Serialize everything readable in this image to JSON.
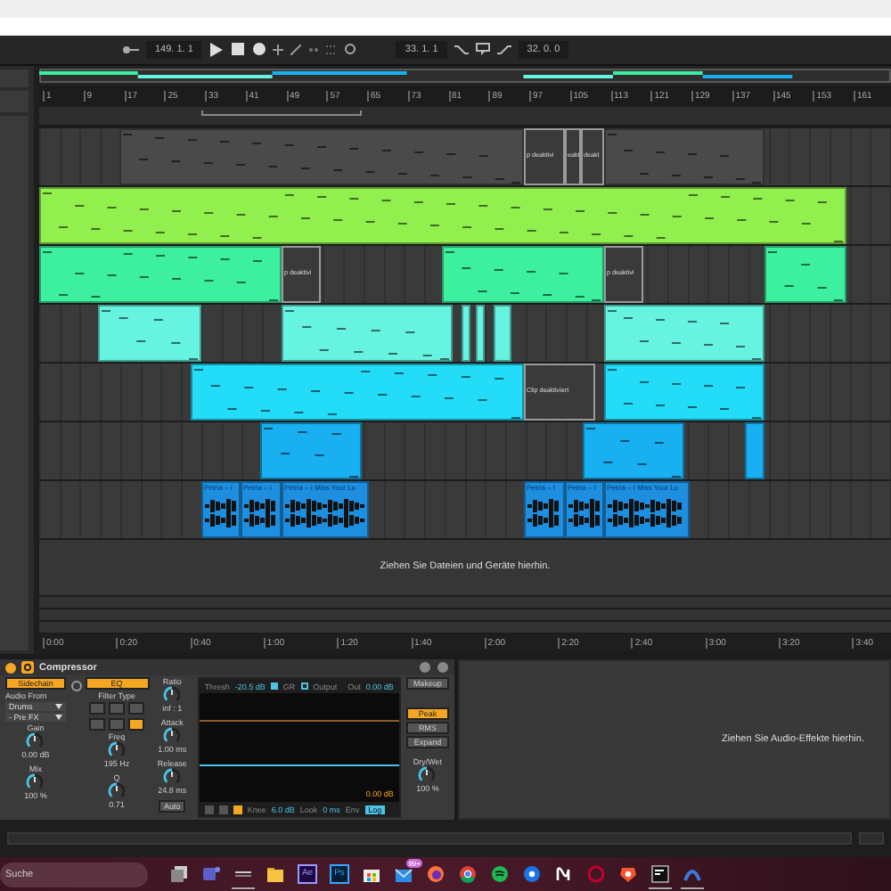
{
  "transport": {
    "position": "149. 1. 1",
    "loop_start": "33. 1. 1",
    "loop_length": "32. 0. 0"
  },
  "ruler": {
    "bars": [
      "1",
      "9",
      "17",
      "25",
      "33",
      "41",
      "49",
      "57",
      "65",
      "73",
      "81",
      "89",
      "97",
      "105",
      "113",
      "121",
      "129",
      "137",
      "145",
      "153",
      "161"
    ],
    "times": [
      "0:00",
      "0:20",
      "0:40",
      "1:00",
      "1:20",
      "1:40",
      "2:00",
      "2:20",
      "2:40",
      "3:00",
      "3:20",
      "3:40"
    ]
  },
  "tracks": [
    {
      "color": "#4a4a4a",
      "clips": [
        {
          "kind": "midi",
          "deactivated": false
        },
        {
          "kind": "midi",
          "deactivated": true,
          "label": "p deaktivi"
        },
        {
          "kind": "midi",
          "deactivated": true,
          "label": "eakt"
        },
        {
          "kind": "midi",
          "deactivated": true,
          "label": "deakt"
        },
        {
          "kind": "midi",
          "deactivated": false
        }
      ]
    },
    {
      "color": "#92f04e",
      "clips": [
        {
          "kind": "midi",
          "deactivated": false
        }
      ]
    },
    {
      "color": "#3cf0a0",
      "clips": [
        {
          "kind": "midi",
          "deactivated": false
        },
        {
          "kind": "midi",
          "deactivated": true,
          "label": "p deaktivi"
        },
        {
          "kind": "midi",
          "deactivated": false
        },
        {
          "kind": "midi",
          "deactivated": true,
          "label": "p deaktivi"
        },
        {
          "kind": "midi",
          "deactivated": false
        }
      ]
    },
    {
      "color": "#66f3df",
      "clips": [
        {
          "kind": "midi",
          "deactivated": false
        },
        {
          "kind": "midi",
          "deactivated": false
        },
        {
          "kind": "midi",
          "deactivated": false
        },
        {
          "kind": "midi",
          "deactivated": false
        },
        {
          "kind": "midi",
          "deactivated": false
        },
        {
          "kind": "midi",
          "deactivated": false
        }
      ]
    },
    {
      "color": "#22dcf8",
      "clips": [
        {
          "kind": "midi",
          "deactivated": false
        },
        {
          "kind": "midi",
          "deactivated": true,
          "label": "Clip deaktiviert"
        },
        {
          "kind": "midi",
          "deactivated": false
        }
      ]
    },
    {
      "color": "#19b0f2",
      "clips": [
        {
          "kind": "midi",
          "deactivated": false
        },
        {
          "kind": "midi",
          "deactivated": false
        },
        {
          "kind": "midi",
          "deactivated": false
        }
      ]
    },
    {
      "color": "#1e8fe0",
      "clips": [
        {
          "kind": "audio",
          "deactivated": false,
          "label": "Petria – I"
        },
        {
          "kind": "audio",
          "deactivated": false,
          "label": "Petria – I"
        },
        {
          "kind": "audio",
          "deactivated": false,
          "label": "Petria – I Miss Your Lo"
        },
        {
          "kind": "audio",
          "deactivated": false,
          "label": "Petria – I"
        },
        {
          "kind": "audio",
          "deactivated": false,
          "label": "Petria – I"
        },
        {
          "kind": "audio",
          "deactivated": false,
          "label": "Petria – I Miss Your Lo"
        }
      ]
    }
  ],
  "drop_hint": "Ziehen Sie Dateien und Geräte hierhin.",
  "device": {
    "title": "Compressor",
    "on": true,
    "sidechain": {
      "label": "Sidechain",
      "on": true
    },
    "eq": {
      "label": "EQ",
      "on": true
    },
    "audio_from": {
      "label": "Audio From",
      "value": "Drums",
      "tap": "- Pre FX"
    },
    "filter_type": {
      "label": "Filter Type",
      "options": [
        {
          "selected": false
        },
        {
          "selected": false
        },
        {
          "selected": false
        },
        {
          "selected": false
        },
        {
          "selected": false
        },
        {
          "selected": true
        }
      ]
    },
    "knobs": [
      {
        "label": "Gain",
        "value": "0.00 dB"
      },
      {
        "label": "Mix",
        "value": "100 %"
      },
      {
        "label": "Freq",
        "value": "195 Hz"
      },
      {
        "label": "Q",
        "value": "0.71"
      },
      {
        "label": "Ratio",
        "value": "inf : 1"
      },
      {
        "label": "Attack",
        "value": "1.00 ms"
      },
      {
        "label": "Release",
        "value": "24.8 ms"
      },
      {
        "label": "Dry/Wet",
        "value": "100 %"
      }
    ],
    "auto": {
      "label": "Auto",
      "on": false
    },
    "display": {
      "thresh_label": "Thresh",
      "thresh": "-20.5 dB",
      "gr": {
        "label": "GR",
        "checked": true
      },
      "output": {
        "label": "Output",
        "checked": false
      },
      "out_label": "Out",
      "out": "0.00 dB",
      "reading": "0.00 dB",
      "buttons": [
        {
          "on": false
        },
        {
          "on": false
        },
        {
          "on": true
        }
      ],
      "knee_label": "Knee",
      "knee": "6.0 dB",
      "look_label": "Look",
      "look": "0 ms",
      "env_label": "Env",
      "env": {
        "label": "Log",
        "on": true
      }
    },
    "makeup": {
      "label": "Makeup",
      "on": false
    },
    "modes": [
      {
        "label": "Peak",
        "selected": true
      },
      {
        "label": "RMS",
        "selected": false
      },
      {
        "label": "Expand",
        "selected": false
      }
    ]
  },
  "effects_hint": "Ziehen Sie Audio-Effekte hierhin.",
  "taskbar": {
    "placeholder": "Suche",
    "apps": [
      {
        "kind": "taskview",
        "running": false
      },
      {
        "kind": "teams",
        "running": false
      },
      {
        "kind": "live",
        "running": true
      },
      {
        "kind": "folder",
        "running": false
      },
      {
        "kind": "ae",
        "label": "Ae",
        "running": false
      },
      {
        "kind": "ps",
        "label": "Ps",
        "running": false
      },
      {
        "kind": "store",
        "running": false
      },
      {
        "kind": "mail",
        "badge": "99+",
        "running": false
      },
      {
        "kind": "firefox",
        "running": false
      },
      {
        "kind": "chrome",
        "running": false
      },
      {
        "kind": "spotify",
        "running": false
      },
      {
        "kind": "bluecircle",
        "running": false
      },
      {
        "kind": "wave",
        "running": false
      },
      {
        "kind": "opera",
        "running": false
      },
      {
        "kind": "brave",
        "running": false
      },
      {
        "kind": "terminal",
        "running": true
      },
      {
        "kind": "arc",
        "running": true
      }
    ]
  }
}
